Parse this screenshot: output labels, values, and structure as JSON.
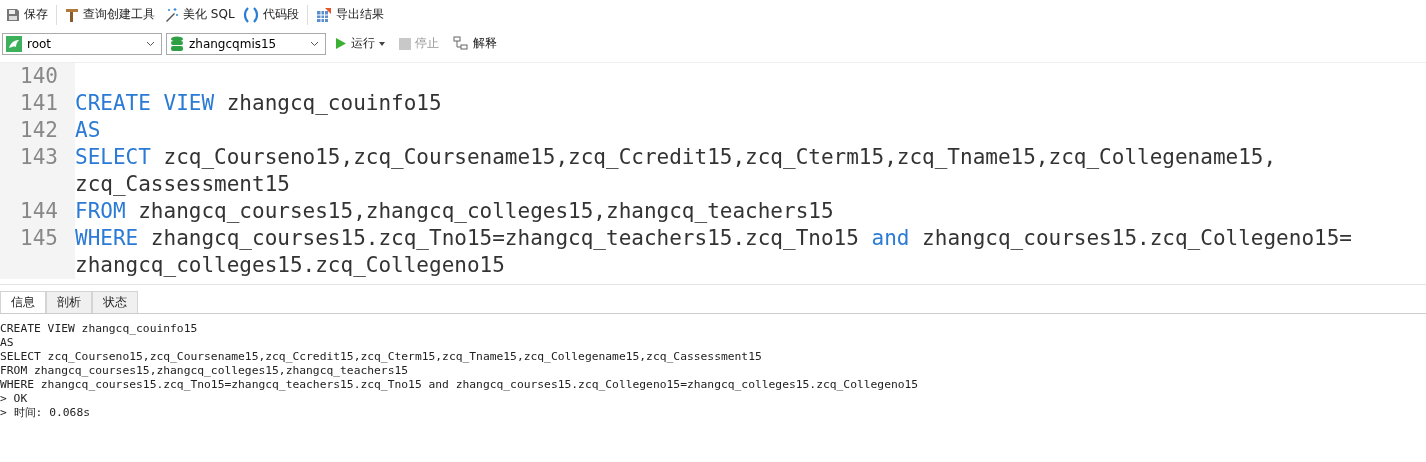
{
  "toolbar": [
    {
      "kind": "save",
      "label": "保存"
    },
    {
      "kind": "builder",
      "label": "查询创建工具"
    },
    {
      "kind": "beautify",
      "label": "美化 SQL"
    },
    {
      "kind": "snippet",
      "label": "代码段"
    },
    {
      "kind": "export",
      "label": "导出结果"
    }
  ],
  "connection": {
    "value": "root"
  },
  "database": {
    "value": "zhangcqmis15"
  },
  "actions": [
    {
      "kind": "run",
      "label": "运行",
      "disabled": false
    },
    {
      "kind": "stop",
      "label": "停止",
      "disabled": true
    },
    {
      "kind": "explain",
      "label": "解释",
      "disabled": false
    }
  ],
  "editor": {
    "lines": [
      {
        "number": "140"
      },
      {
        "number": "141",
        "rows": [
          [
            {
              "kind": "keyword",
              "text": "CREATE VIEW"
            },
            {
              "kind": "plain",
              "text": " zhangcq_couinfo15"
            }
          ]
        ]
      },
      {
        "number": "142",
        "rows": [
          [
            {
              "kind": "keyword",
              "text": "AS"
            }
          ]
        ]
      },
      {
        "number": "143",
        "rows": [
          [
            {
              "kind": "keyword",
              "text": "SELECT"
            },
            {
              "kind": "plain",
              "text": " zcq_Courseno15,zcq_Coursename15,zcq_Ccredit15,zcq_Cterm15,zcq_Tname15,zcq_Collegename15,"
            }
          ],
          [
            {
              "kind": "plain",
              "text": "zcq_Cassessment15"
            }
          ]
        ]
      },
      {
        "number": "144",
        "rows": [
          [
            {
              "kind": "keyword",
              "text": "FROM"
            },
            {
              "kind": "plain",
              "text": " zhangcq_courses15,zhangcq_colleges15,zhangcq_teachers15"
            }
          ]
        ]
      },
      {
        "number": "145",
        "rows": [
          [
            {
              "kind": "keyword",
              "text": "WHERE"
            },
            {
              "kind": "plain",
              "text": " zhangcq_courses15.zcq_Tno15=zhangcq_teachers15.zcq_Tno15 "
            },
            {
              "kind": "keyword",
              "text": "and"
            },
            {
              "kind": "plain",
              "text": " zhangcq_courses15.zcq_Collegeno15="
            }
          ],
          [
            {
              "kind": "plain",
              "text": "zhangcq_colleges15.zcq_Collegeno15"
            }
          ]
        ]
      }
    ]
  },
  "result_tabs": [
    {
      "label": "信息",
      "selected": true
    },
    {
      "label": "剖析",
      "selected": false
    },
    {
      "label": "状态",
      "selected": false
    }
  ],
  "output": [
    "CREATE VIEW zhangcq_couinfo15",
    "AS",
    "SELECT zcq_Courseno15,zcq_Coursename15,zcq_Ccredit15,zcq_Cterm15,zcq_Tname15,zcq_Collegename15,zcq_Cassessment15",
    "FROM zhangcq_courses15,zhangcq_colleges15,zhangcq_teachers15",
    "WHERE zhangcq_courses15.zcq_Tno15=zhangcq_teachers15.zcq_Tno15 and zhangcq_courses15.zcq_Collegeno15=zhangcq_colleges15.zcq_Collegeno15",
    "> OK",
    "> 时间: 0.068s"
  ]
}
